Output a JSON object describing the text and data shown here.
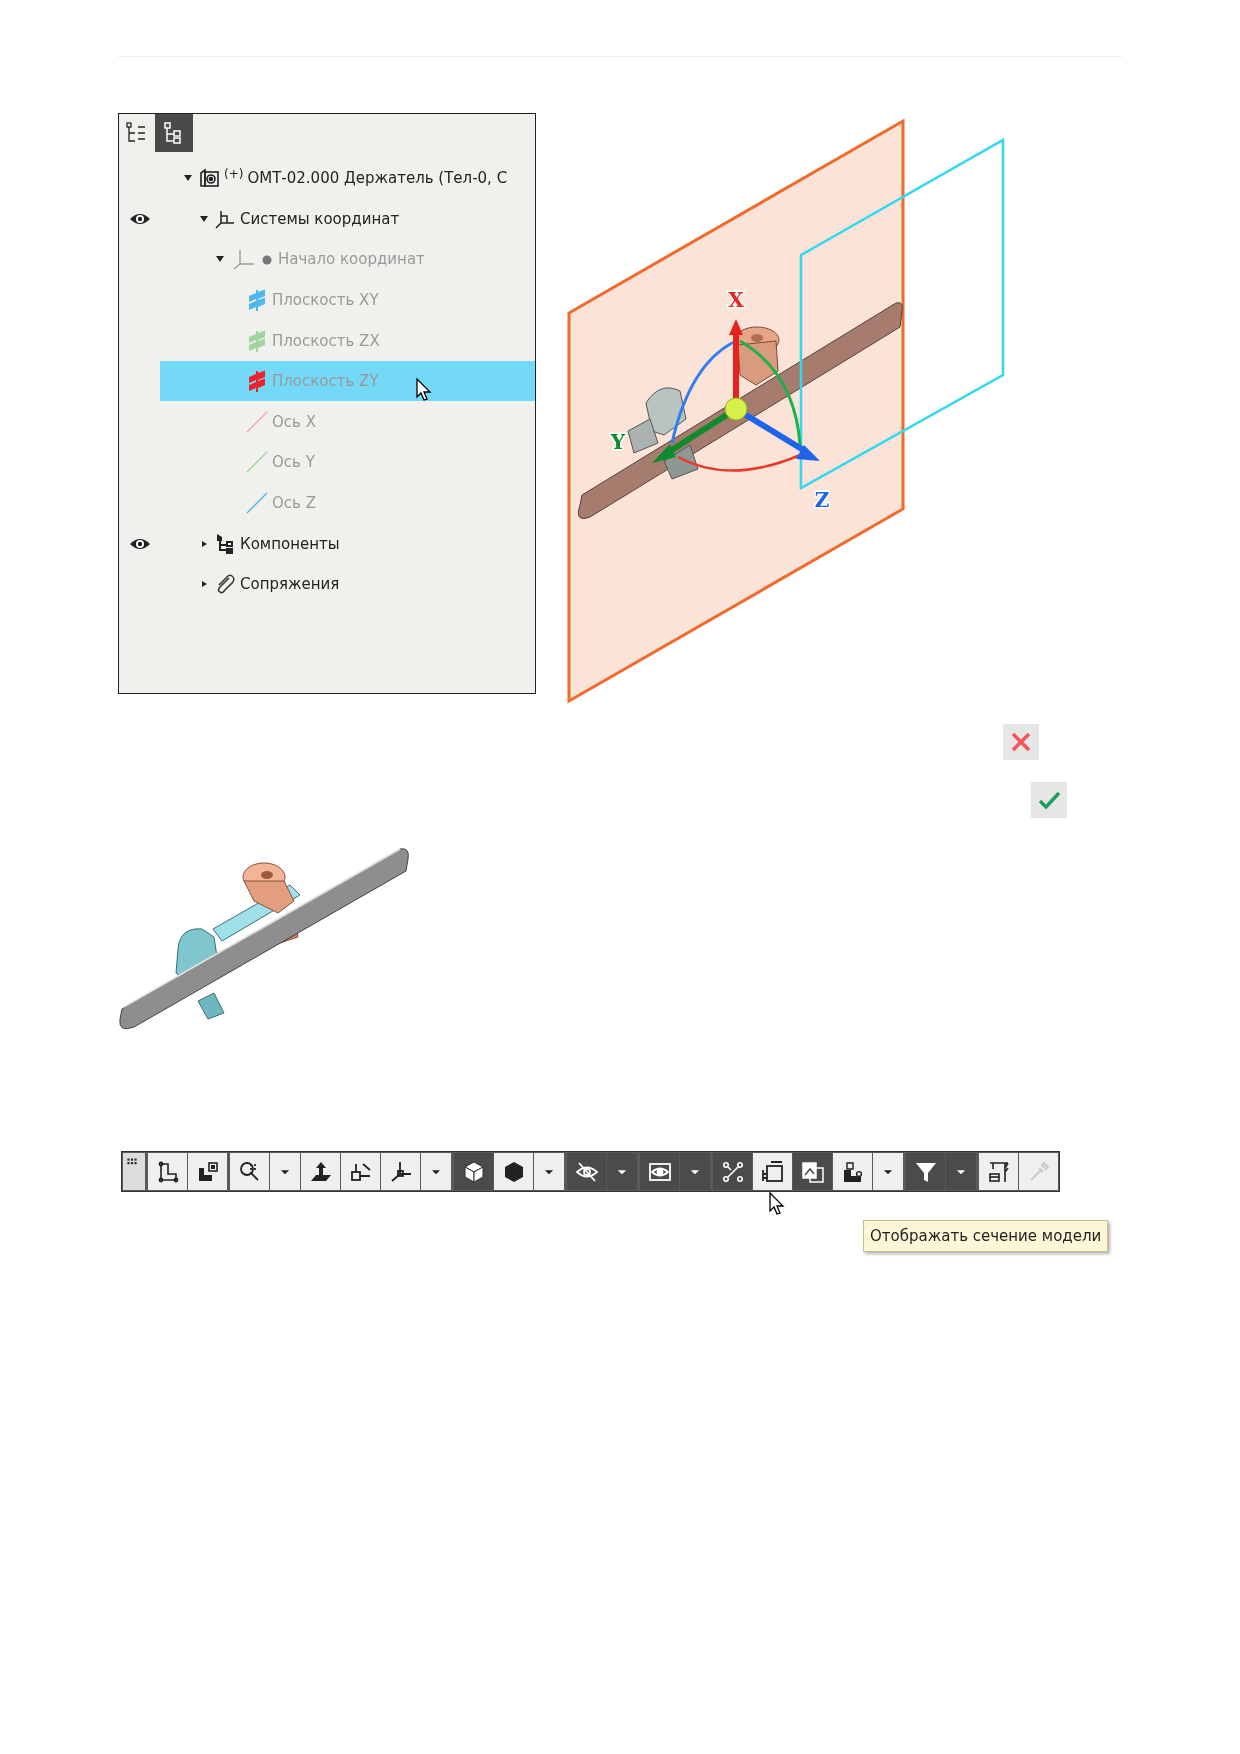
{
  "tree_panel": {
    "tabs": [
      {
        "kind": "numbered",
        "selected": false
      },
      {
        "kind": "structure",
        "selected": true
      }
    ],
    "items": [
      {
        "kind": "assembly",
        "marker": "(+)",
        "label": "ОМТ-02.000 Держатель (Тел-0, С",
        "expanded": true,
        "visible": false,
        "dimmed": false,
        "selected": false,
        "children": [
          {
            "kind": "csys",
            "label": "Системы координат",
            "expanded": true,
            "visible": true,
            "dimmed": false,
            "selected": false,
            "children": [
              {
                "kind": "origin",
                "label": "Начало координат",
                "expanded": true,
                "visible": false,
                "dimmed": true,
                "selected": false,
                "children": [
                  {
                    "kind": "plane",
                    "label": "Плоскость XY",
                    "color": "#4fb6ee",
                    "visible": false,
                    "dimmed": true,
                    "selected": false
                  },
                  {
                    "kind": "plane",
                    "label": "Плоскость ZX",
                    "color": "#9fd49f",
                    "visible": false,
                    "dimmed": true,
                    "selected": false
                  },
                  {
                    "kind": "plane",
                    "label": "Плоскость ZY",
                    "color": "#e8232a",
                    "visible": false,
                    "dimmed": true,
                    "selected": true
                  },
                  {
                    "kind": "axis",
                    "label": "Ось X",
                    "color": "#f3a7a7",
                    "visible": false,
                    "dimmed": true,
                    "selected": false
                  },
                  {
                    "kind": "axis",
                    "label": "Ось Y",
                    "color": "#9fd49f",
                    "visible": false,
                    "dimmed": true,
                    "selected": false
                  },
                  {
                    "kind": "axis",
                    "label": "Ось Z",
                    "color": "#4fb6ee",
                    "visible": false,
                    "dimmed": true,
                    "selected": false
                  }
                ]
              }
            ]
          },
          {
            "kind": "components",
            "label": "Компоненты",
            "expanded": false,
            "visible": true,
            "dimmed": false,
            "selected": false
          },
          {
            "kind": "mates",
            "label": "Сопряжения",
            "expanded": false,
            "visible": false,
            "dimmed": false,
            "selected": false
          }
        ]
      }
    ]
  },
  "viewport": {
    "axes": [
      {
        "label": "X"
      },
      {
        "label": "Y"
      },
      {
        "label": "Z"
      }
    ]
  },
  "dialog_buttons": [
    {
      "kind": "cancel"
    },
    {
      "kind": "ok"
    }
  ],
  "toolbar": {
    "groups": [
      {
        "items": [
          {
            "kind": "grip",
            "pressed": false,
            "disabled": false
          }
        ]
      },
      {
        "items": [
          {
            "kind": "sketch",
            "pressed": false,
            "disabled": false
          },
          {
            "kind": "part-view",
            "pressed": false,
            "disabled": false
          }
        ]
      },
      {
        "items": [
          {
            "kind": "zoom-window",
            "pressed": false,
            "disabled": false
          },
          {
            "kind": "dropdown",
            "pressed": false,
            "disabled": false
          },
          {
            "kind": "lift",
            "pressed": false,
            "disabled": false
          },
          {
            "kind": "move",
            "pressed": false,
            "disabled": false
          },
          {
            "kind": "triad",
            "pressed": false,
            "disabled": false
          },
          {
            "kind": "dropdown",
            "pressed": false,
            "disabled": false
          }
        ]
      },
      {
        "items": [
          {
            "kind": "cube",
            "pressed": true,
            "disabled": false
          },
          {
            "kind": "hexagon",
            "pressed": false,
            "disabled": false
          },
          {
            "kind": "dropdown",
            "pressed": false,
            "disabled": false
          }
        ]
      },
      {
        "items": [
          {
            "kind": "hide",
            "pressed": true,
            "disabled": false
          },
          {
            "kind": "dropdown",
            "pressed": true,
            "disabled": false
          }
        ]
      },
      {
        "items": [
          {
            "kind": "eye-box",
            "pressed": true,
            "disabled": false
          },
          {
            "kind": "dropdown",
            "pressed": true,
            "disabled": false
          }
        ]
      },
      {
        "items": [
          {
            "kind": "nodes",
            "pressed": true,
            "disabled": false
          },
          {
            "kind": "frame",
            "pressed": false,
            "disabled": false
          },
          {
            "kind": "image",
            "pressed": true,
            "disabled": false
          },
          {
            "kind": "section",
            "pressed": false,
            "disabled": false
          },
          {
            "kind": "dropdown",
            "pressed": false,
            "disabled": false
          }
        ]
      },
      {
        "items": [
          {
            "kind": "filter",
            "pressed": true,
            "disabled": false
          },
          {
            "kind": "dropdown",
            "pressed": true,
            "disabled": false
          }
        ]
      },
      {
        "items": [
          {
            "kind": "crane",
            "pressed": false,
            "disabled": false
          },
          {
            "kind": "pipette",
            "pressed": false,
            "disabled": true
          }
        ]
      }
    ]
  },
  "tooltip": {
    "text": "Отображать сечение модели"
  }
}
